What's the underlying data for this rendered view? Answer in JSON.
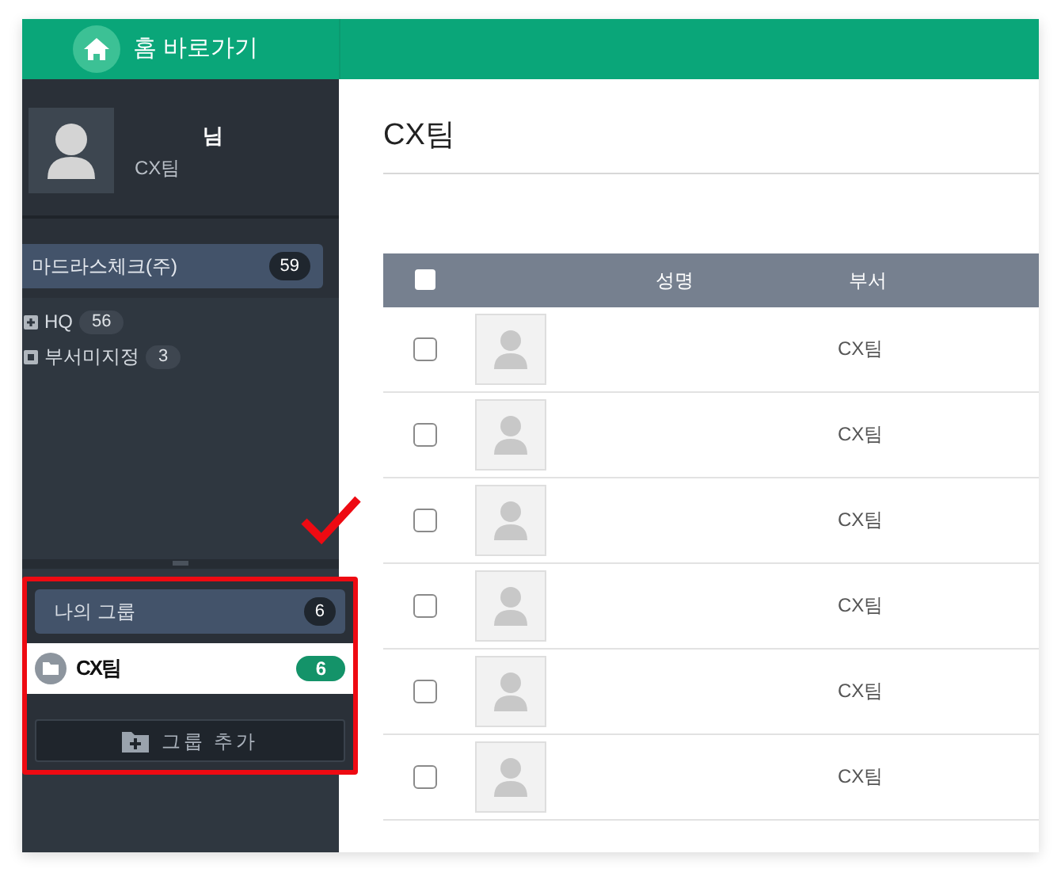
{
  "top_bar": {
    "home_link": "홈 바로가기"
  },
  "profile": {
    "name": "님",
    "team": "CX팀"
  },
  "company": {
    "label": "마드라스체크(주)",
    "count": "59"
  },
  "departments": [
    {
      "kind": "expandable",
      "label": "HQ",
      "count": "56"
    },
    {
      "kind": "leaf",
      "label": "부서미지정",
      "count": "3"
    }
  ],
  "my_groups": {
    "label": "나의 그룹",
    "count": "6",
    "groups": [
      {
        "label": "CX팀",
        "count": "6",
        "selected": true
      }
    ],
    "add_button": "그룹 추가"
  },
  "main": {
    "title": "CX팀",
    "table": {
      "columns": [
        "성명",
        "부서"
      ],
      "header_checked": false,
      "rows": [
        {
          "checked": false,
          "department": "CX팀"
        },
        {
          "checked": false,
          "department": "CX팀"
        },
        {
          "checked": false,
          "department": "CX팀"
        },
        {
          "checked": false,
          "department": "CX팀"
        },
        {
          "checked": false,
          "department": "CX팀"
        },
        {
          "checked": false,
          "department": "CX팀"
        }
      ]
    }
  }
}
